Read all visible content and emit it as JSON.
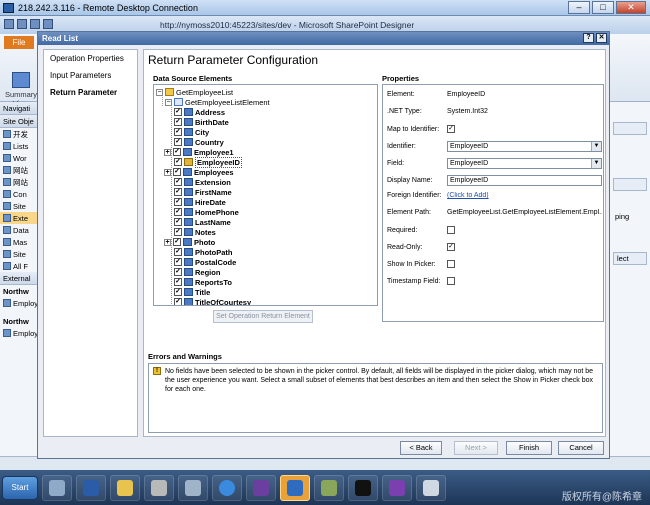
{
  "rdp": {
    "title": "218.242.3.116 - Remote Desktop Connection"
  },
  "spd": {
    "title": "http://nymoss2010:45223/sites/dev - Microsoft SharePoint Designer",
    "file_tab": "File",
    "summary_label": "Summary View",
    "nav_header": "Navigati",
    "nav_section": "Site Obje",
    "nav_items": [
      "开发",
      "Lists",
      "Wor",
      "网站",
      "网站",
      "Con",
      "Site",
      "Exte",
      "Data",
      "Mas",
      "Site",
      "All F"
    ],
    "external_header": "External",
    "northwind1": "Northw",
    "employ1": "Employ",
    "northwind2": "Northw",
    "employ2": "Employ",
    "right_text": "ping",
    "right_btn": "lect"
  },
  "dialog": {
    "title": "Read List",
    "steps": [
      "Operation Properties",
      "Input Parameters",
      "Return Parameter"
    ],
    "heading": "Return Parameter Configuration",
    "dse_label": "Data Source Elements",
    "props_label": "Properties",
    "tree": {
      "root": "GetEmployeeList",
      "element": "GetEmployeeListElement",
      "fields": [
        {
          "name": "Address",
          "bold": true
        },
        {
          "name": "BirthDate",
          "bold": true
        },
        {
          "name": "City",
          "bold": true
        },
        {
          "name": "Country",
          "bold": true
        },
        {
          "name": "Employee1",
          "bold": true,
          "expand": true
        },
        {
          "name": "EmployeeID",
          "bold": true,
          "key": true,
          "selected": true
        },
        {
          "name": "Employees",
          "bold": true,
          "expand": true
        },
        {
          "name": "Extension",
          "bold": true
        },
        {
          "name": "FirstName",
          "bold": true
        },
        {
          "name": "HireDate",
          "bold": true
        },
        {
          "name": "HomePhone",
          "bold": true
        },
        {
          "name": "LastName",
          "bold": true
        },
        {
          "name": "Notes",
          "bold": true
        },
        {
          "name": "Photo",
          "bold": true,
          "expand": true
        },
        {
          "name": "PhotoPath",
          "bold": true
        },
        {
          "name": "PostalCode",
          "bold": true
        },
        {
          "name": "Region",
          "bold": true
        },
        {
          "name": "ReportsTo",
          "bold": true
        },
        {
          "name": "Title",
          "bold": true
        },
        {
          "name": "TitleOfCourtesy",
          "bold": true
        }
      ]
    },
    "set_button": "Set Operation Return Element",
    "properties": {
      "element_label": "Element:",
      "element_value": "EmployeeID",
      "nettype_label": ".NET Type:",
      "nettype_value": "System.Int32",
      "map_label": "Map to Identifier:",
      "map_checked": true,
      "identifier_label": "Identifier:",
      "identifier_value": "EmployeeID",
      "field_label": "Field:",
      "field_value": "EmployeeID",
      "display_label": "Display Name:",
      "display_value": "EmployeeID",
      "foreign_label": "Foreign Identifier:",
      "foreign_value": "(Click to Add)",
      "path_label": "Element Path:",
      "path_value": "GetEmployeeList.GetEmployeeListElement.Empl...",
      "required_label": "Required:",
      "required_checked": false,
      "readonly_label": "Read-Only:",
      "readonly_checked": true,
      "showpicker_label": "Show In Picker:",
      "showpicker_checked": false,
      "timestamp_label": "Timestamp Field:",
      "timestamp_checked": false
    },
    "errors_label": "Errors and Warnings",
    "warning": "No fields have been selected to be shown in the picker control. By default, all fields will be displayed in the picker dialog, which may not be the user experience you want. Select a small subset of elements that best describes an item and then select the Show in Picker check box for each one.",
    "buttons": {
      "back": "< Back",
      "next": "Next >",
      "finish": "Finish",
      "cancel": "Cancel"
    }
  },
  "taskbar": {
    "start": "Start",
    "watermark": "版权所有@陈希章"
  }
}
